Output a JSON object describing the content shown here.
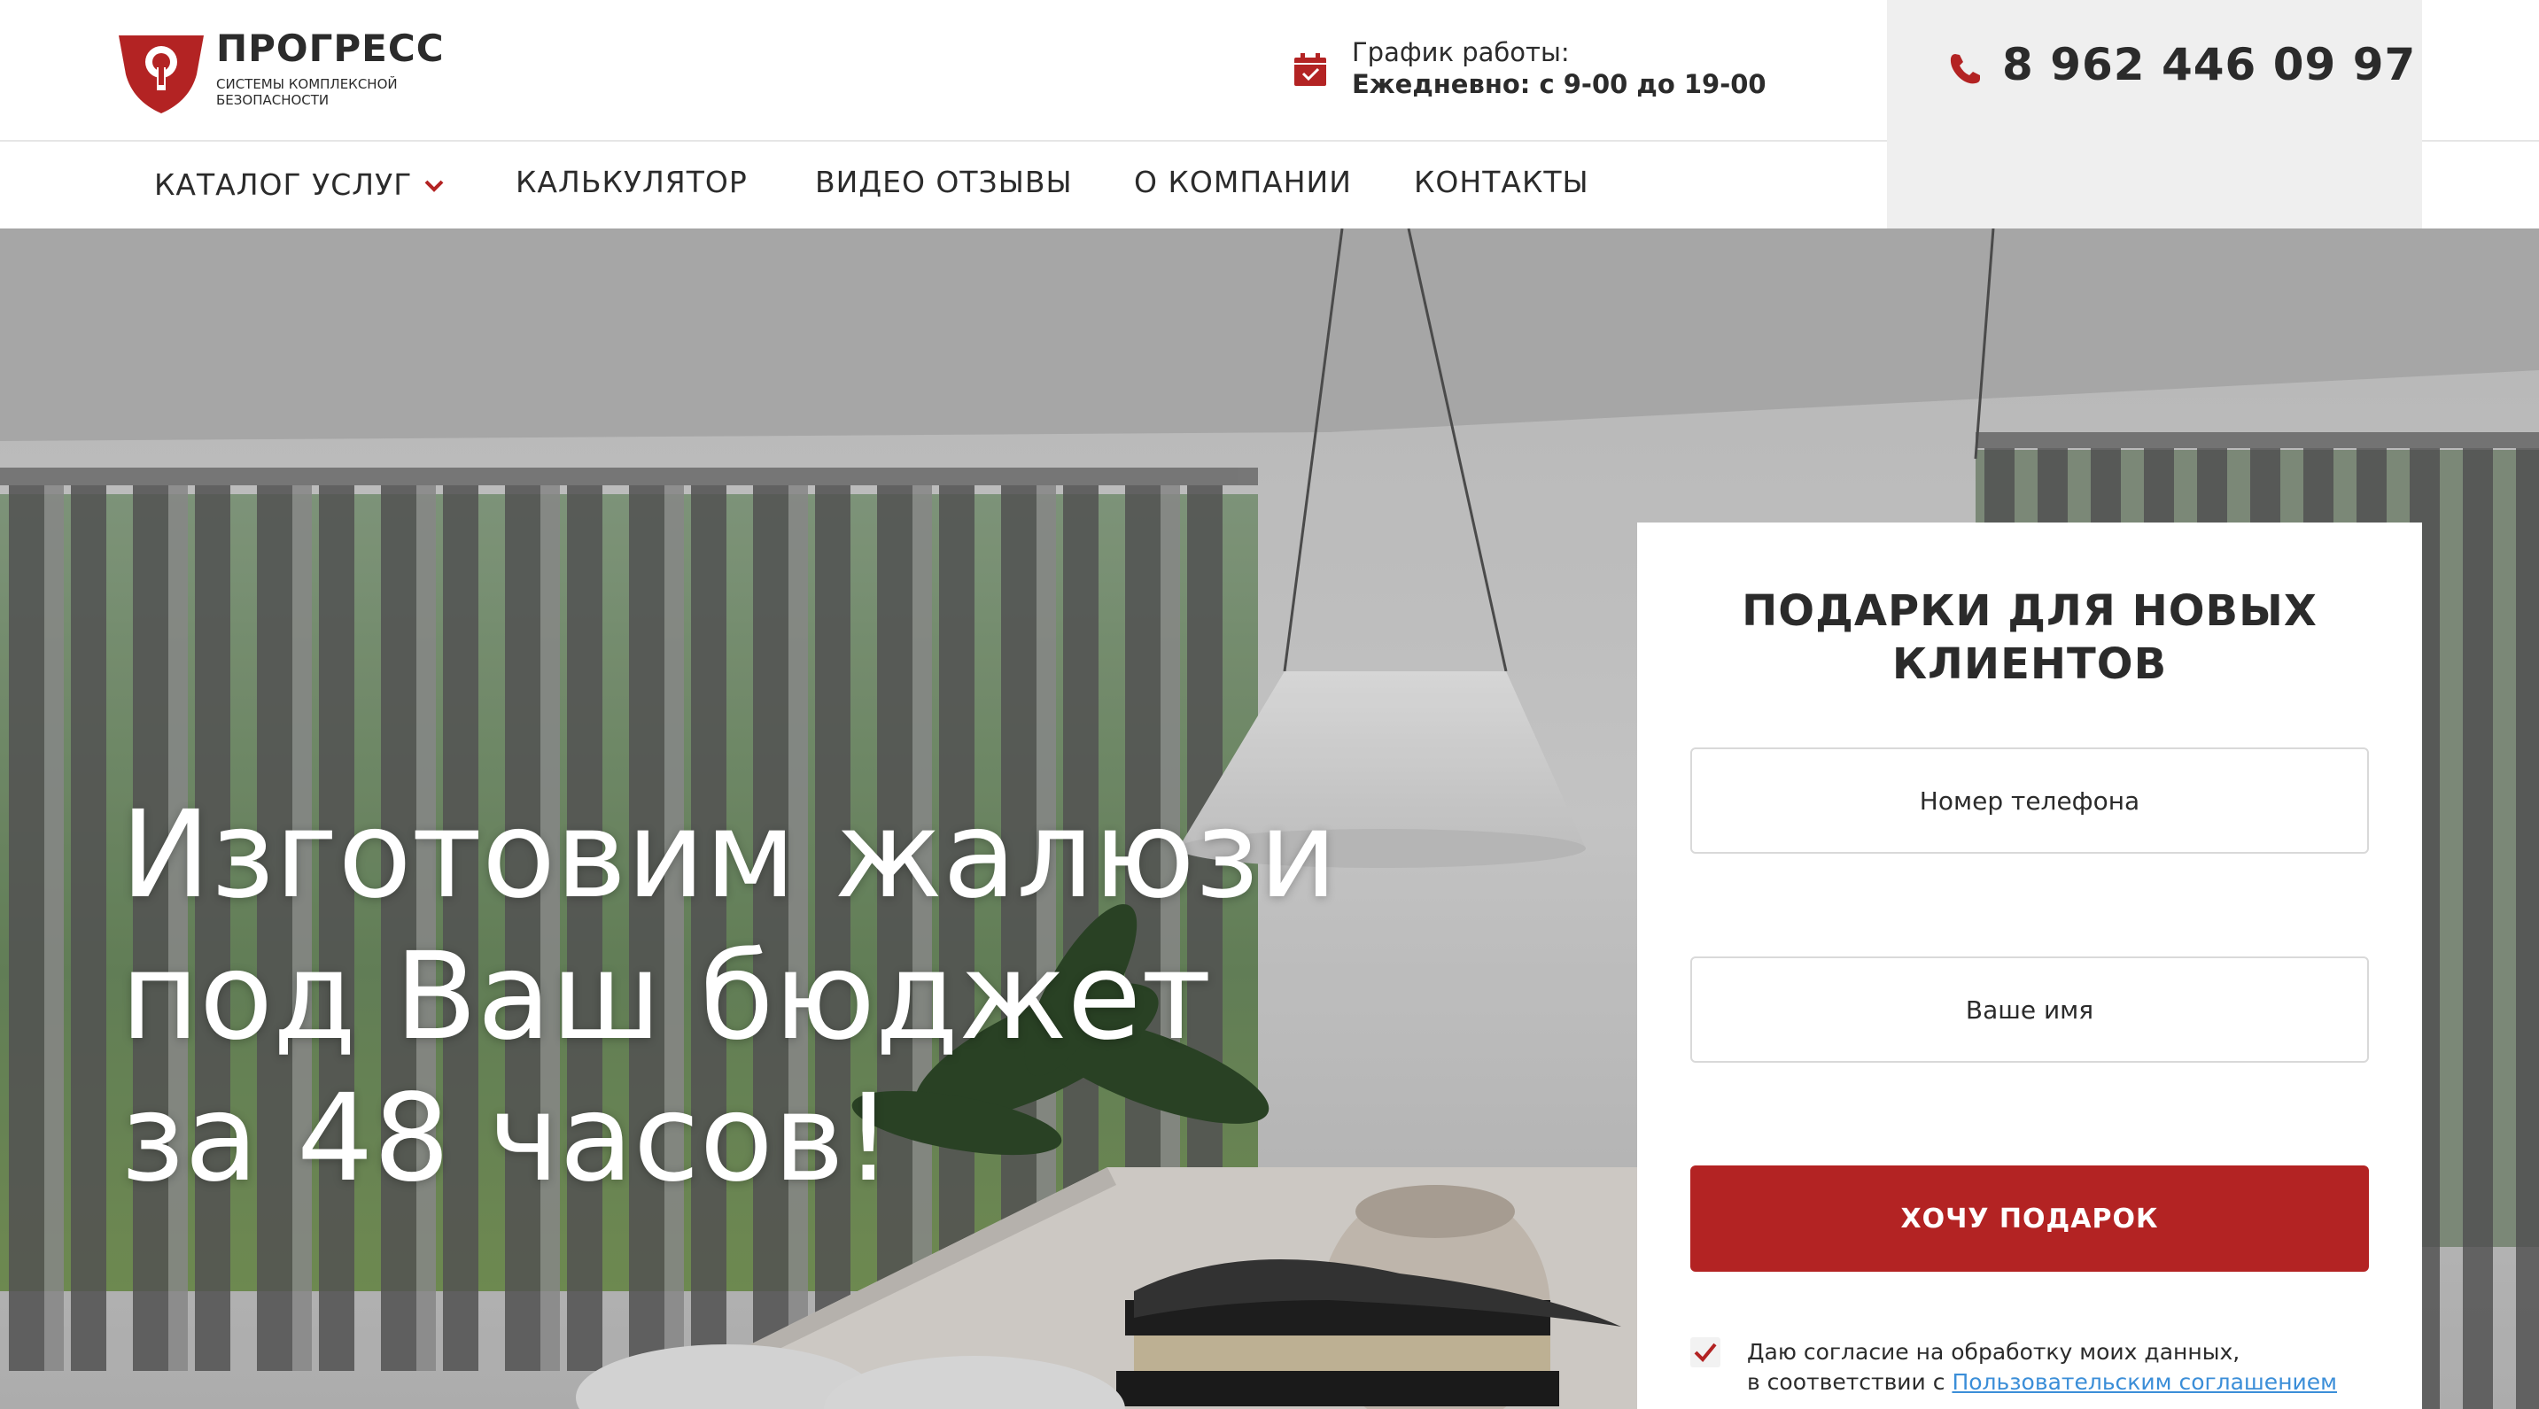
{
  "brand": {
    "name": "ПРОГРЕСС",
    "tagline": "СИСТЕМЫ КОМПЛЕКСНОЙ БЕЗОПАСНОСТИ",
    "accent_color": "#b32323"
  },
  "schedule": {
    "icon": "calendar-icon",
    "label": "График работы:",
    "value": "Ежедневно: с 9-00 до 19-00"
  },
  "contact": {
    "icon": "phone-icon",
    "phone": "8 962 446 09 97"
  },
  "nav": {
    "items": [
      {
        "label": "КАТАЛОГ УСЛУГ",
        "has_dropdown": true
      },
      {
        "label": "КАЛЬКУЛЯТОР"
      },
      {
        "label": "ВИДЕО ОТЗЫВЫ"
      },
      {
        "label": "О КОМПАНИИ"
      },
      {
        "label": "КОНТАКТЫ"
      }
    ]
  },
  "hero": {
    "title": "Изготовим жалюзи под Ваш бюджет за 48 часов!"
  },
  "gift_form": {
    "title": "ПОДАРКИ ДЛЯ НОВЫХ КЛИЕНТОВ",
    "phone_placeholder": "Номер телефона",
    "name_placeholder": "Ваше имя",
    "submit_label": "ХОЧУ ПОДАРОК",
    "consent_checked": true,
    "consent_line1": "Даю согласие на обработку моих данных,",
    "consent_line2_prefix": "в соответствии с",
    "consent_link": "Пользовательским соглашением"
  }
}
